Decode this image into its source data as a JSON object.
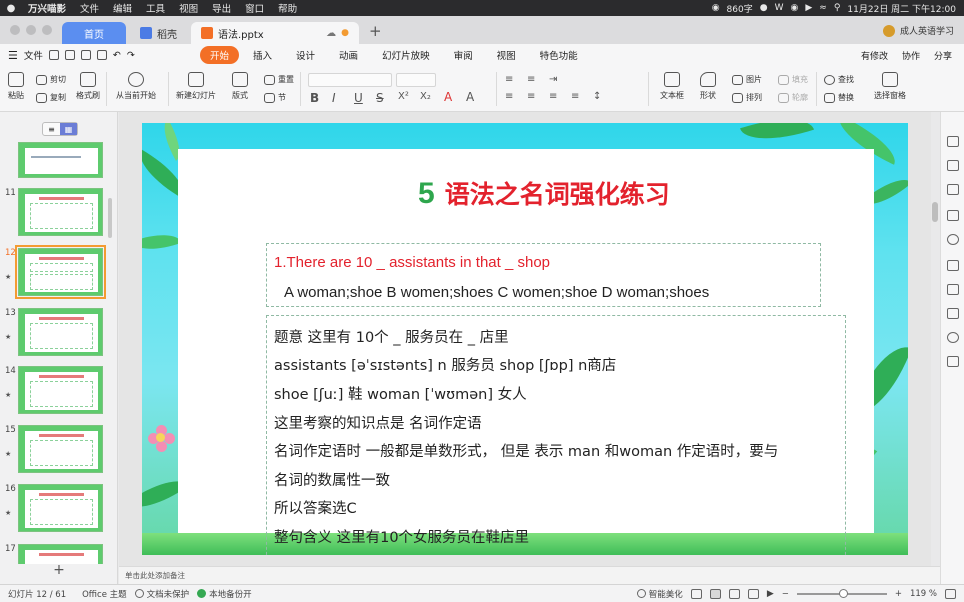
{
  "menubar": {
    "app_name": "万兴喵影",
    "menus": [
      "文件",
      "编辑",
      "工具",
      "视图",
      "导出",
      "窗口",
      "帮助"
    ],
    "status_items": [
      "860字",
      "11月22日 周二 下午12:00"
    ]
  },
  "tabs": {
    "home": "首页",
    "second": "稻壳",
    "active_file": "语法.pptx",
    "account": "成人英语学习"
  },
  "ribbon": {
    "file_menu": "文件",
    "tabs": [
      "开始",
      "插入",
      "设计",
      "动画",
      "幻灯片放映",
      "审阅",
      "视图",
      "特色功能"
    ],
    "active_tab": "开始",
    "right_actions": [
      "有修改",
      "协作",
      "分享"
    ]
  },
  "tools": {
    "paste": "粘贴",
    "cut": "剪切",
    "copy": "复制",
    "format_painter": "格式刷",
    "play_from_start": "从当前开始",
    "new_slide": "新建幻灯片",
    "layout": "版式",
    "reset": "重置",
    "section": "节",
    "textbox": "文本框",
    "shape": "形状",
    "picture": "图片",
    "fill": "填充",
    "arrange": "排列",
    "outline": "轮廓",
    "find": "查找",
    "replace": "替换",
    "select_pane": "选择窗格",
    "bold": "B",
    "italic": "I",
    "underline": "U",
    "strike": "S"
  },
  "thumbnails": {
    "numbers": [
      "11",
      "12",
      "13",
      "14",
      "15",
      "16",
      "17"
    ],
    "selected": "12",
    "add_label": "+"
  },
  "slide": {
    "number": "5",
    "title": "语法之名词强化练习",
    "question": "1.There are 10 _ assistants in that _ shop",
    "options": "A woman;shoe  B women;shoes  C women;shoe D woman;shoes",
    "explanation": [
      "题意 这里有 10个 _ 服务员在 _ 店里",
      "assistants [əˈsɪstənts]  n 服务员    shop [ʃɒp]  n商店",
      "shoe [ʃuː] 鞋 woman [ˈwʊmən] 女人",
      "这里考察的知识点是 名词作定语",
      "名词作定语时 一般都是单数形式， 但是 表示 man 和woman 作定语时，要与",
      "名词的数属性一致",
      "所以答案选C",
      "整句含义 这里有10个女服务员在鞋店里"
    ]
  },
  "notes_placeholder": "单击此处添加备注",
  "statusbar": {
    "slide_count": "幻灯片 12 / 61",
    "theme": "Office 主题",
    "protect": "文档未保护",
    "backup": "本地备份开",
    "beautify": "智能美化",
    "zoom": "119 %"
  },
  "colors": {
    "accent_orange": "#f36f26",
    "title_red": "#e3222d",
    "number_green": "#2ea64d",
    "home_tab_blue": "#5b8ef0"
  }
}
